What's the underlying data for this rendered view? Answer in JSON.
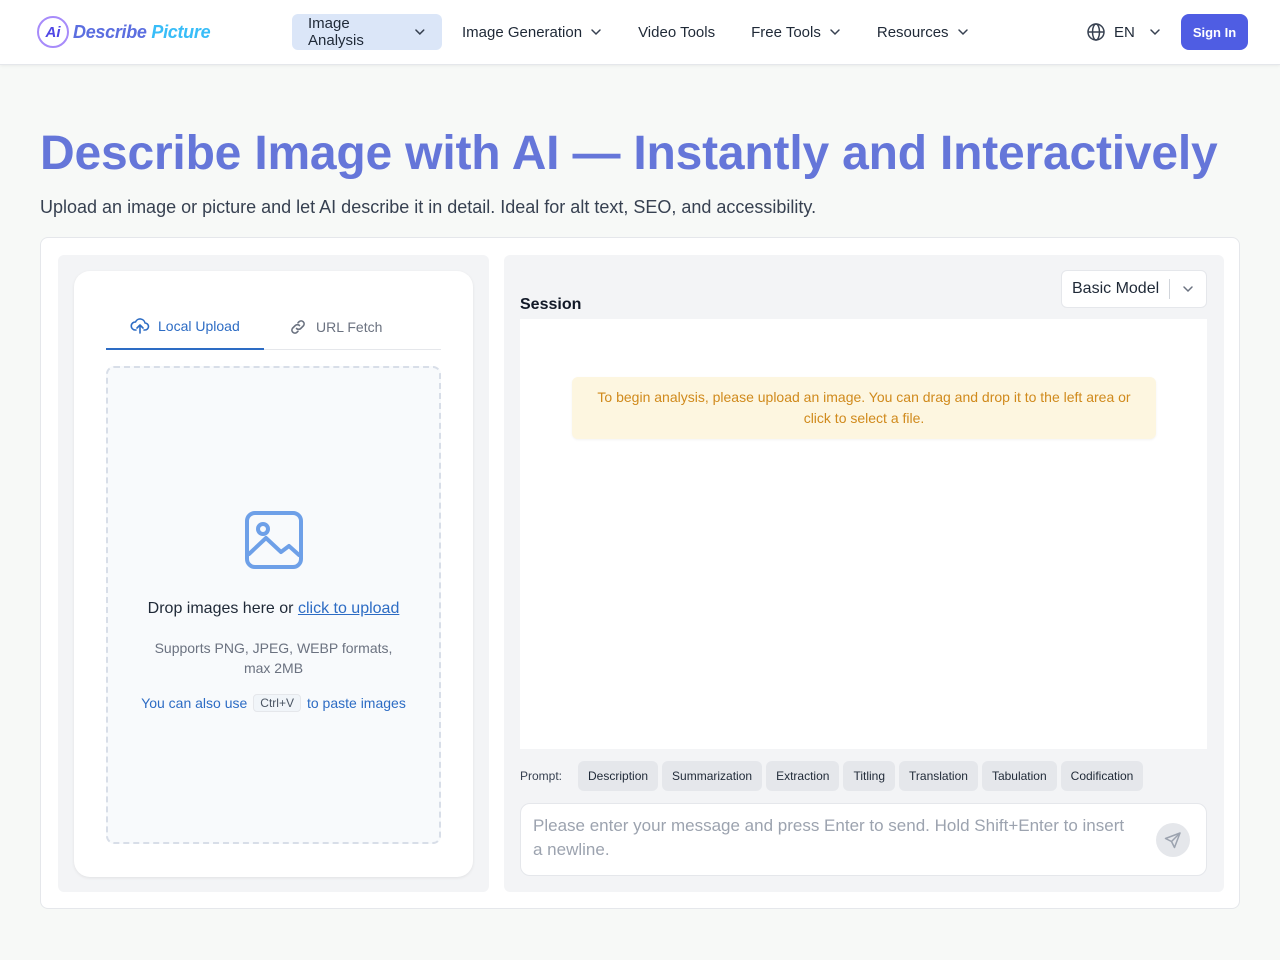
{
  "header": {
    "logo_badge": "Ai",
    "logo_text_main": "Describe",
    "logo_text_accent": "Picture",
    "nav": [
      {
        "label": "Image Analysis",
        "has_dropdown": true,
        "active": true
      },
      {
        "label": "Image Generation",
        "has_dropdown": true,
        "active": false
      },
      {
        "label": "Video Tools",
        "has_dropdown": false,
        "active": false
      },
      {
        "label": "Free Tools",
        "has_dropdown": true,
        "active": false
      },
      {
        "label": "Resources",
        "has_dropdown": true,
        "active": false
      }
    ],
    "language": "EN",
    "sign_in": "Sign In"
  },
  "hero": {
    "title": "Describe Image with AI — Instantly and Interactively",
    "subtitle": "Upload an image or picture and let AI describe it in detail. Ideal for alt text, SEO, and accessibility."
  },
  "upload": {
    "tabs": [
      {
        "label": "Local Upload",
        "icon": "cloud-upload-icon",
        "active": true
      },
      {
        "label": "URL Fetch",
        "icon": "link-icon",
        "active": false
      }
    ],
    "drop_text": "Drop images here or",
    "click_to_upload": "click to upload",
    "supports": "Supports PNG, JPEG, WEBP formats, max 2MB",
    "paste_prefix": "You can also use",
    "paste_key": "Ctrl+V",
    "paste_suffix": "to paste images"
  },
  "session": {
    "title": "Session",
    "model": "Basic Model",
    "notice": "To begin analysis, please upload an image. You can drag and drop it to the left area or click to select a file.",
    "prompt_label": "Prompt:",
    "prompts": [
      "Description",
      "Summarization",
      "Extraction",
      "Titling",
      "Translation",
      "Tabulation",
      "Codification"
    ],
    "input_placeholder": "Please enter your message and press Enter to send. Hold Shift+Enter to insert a newline."
  },
  "colors": {
    "brand": "#4f5de3",
    "hero_title": "#6576d9",
    "link": "#2d6cc4",
    "notice_text": "#d08a1c",
    "notice_bg": "#fdf6e0"
  }
}
